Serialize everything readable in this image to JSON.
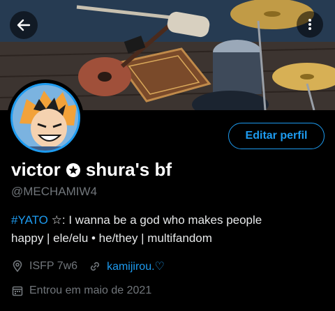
{
  "header": {
    "back_icon": "arrow-left-icon",
    "more_icon": "more-vertical-icon"
  },
  "profile": {
    "display_name_part1": "victor",
    "display_name_part2": "shura's bf",
    "name_separator_icon": "star-circle-icon",
    "handle": "@MECHAMIW4",
    "edit_button_label": "Editar perfil",
    "bio_hashtag": "#YATO",
    "bio_line1_rest": " ☆: I wanna be a god who makes people",
    "bio_line2": "happy |  ele/elu • he/they | multifandom",
    "location": "ISFP 7w6",
    "website": "kamijirou.♡",
    "joined": "Entrou em maio de 2021"
  },
  "colors": {
    "accent": "#1d9bf0",
    "background": "#000000",
    "text_primary": "#e7e9ea",
    "text_secondary": "#71767b"
  }
}
